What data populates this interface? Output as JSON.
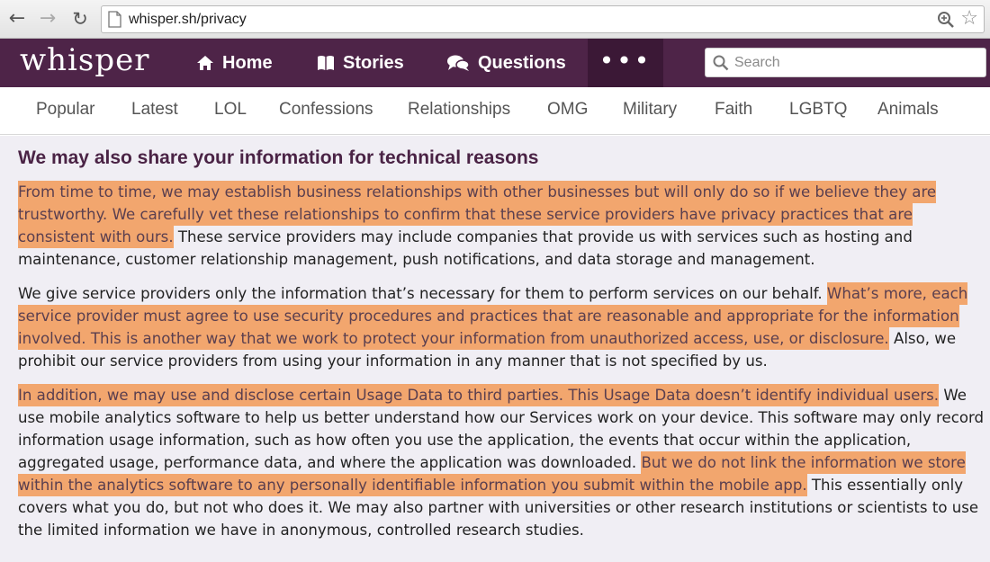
{
  "browser": {
    "url": "whisper.sh/privacy"
  },
  "header": {
    "logo": "whisper",
    "nav": [
      {
        "label": "Home",
        "icon": "home-icon"
      },
      {
        "label": "Stories",
        "icon": "book-icon"
      },
      {
        "label": "Questions",
        "icon": "chat-bubbles-icon"
      }
    ],
    "more_label": "•••",
    "search_placeholder": "Search"
  },
  "categories": [
    "Popular",
    "Latest",
    "LOL",
    "Confessions",
    "Relationships",
    "OMG",
    "Military",
    "Faith",
    "LGBTQ",
    "Animals"
  ],
  "content": {
    "heading": "We may also share your information for technical reasons",
    "paragraphs": [
      [
        {
          "text": "From time to time, we may establish business relationships with other businesses but will only do so if we believe they are trustworthy. We carefully vet these relationships to confirm that these service providers have privacy practices that are consistent with ours.",
          "highlight": true
        },
        {
          "text": " These service providers may include companies that provide us with services such as hosting and maintenance, customer relationship management, push notifications, and data storage and management.",
          "highlight": false
        }
      ],
      [
        {
          "text": "We give service providers only the information that’s necessary for them to perform services on our behalf. ",
          "highlight": false
        },
        {
          "text": "What’s more, each service provider must agree to use security procedures and practices that are reasonable and appropriate for the information involved. This is another way that we work to protect your information from unauthorized access, use, or disclosure.",
          "highlight": true
        },
        {
          "text": " Also, we prohibit our service providers from using your information in any manner that is not specified by us.",
          "highlight": false
        }
      ],
      [
        {
          "text": "In addition, we may use and disclose certain Usage Data to third parties. This Usage Data doesn’t identify individual users.",
          "highlight": true
        },
        {
          "text": " We use mobile analytics software to help us better understand how our Services work on your device. This software may only record information usage information, such as how often you use the application, the events that occur within the application, aggregated usage, performance data, and where the application was downloaded. ",
          "highlight": false
        },
        {
          "text": "But we do not link the information we store within the analytics software to any personally identifiable information you submit within the mobile app.",
          "highlight": true
        },
        {
          "text": " This essentially only covers what you do, but not who does it. We may also partner with universities or other research institutions or scientists to use the limited information we have in anonymous, controlled research studies.",
          "highlight": false
        }
      ]
    ]
  },
  "colors": {
    "header_bg": "#4e2448",
    "highlight": "#f2a66e",
    "content_bg": "#f0eef4"
  }
}
